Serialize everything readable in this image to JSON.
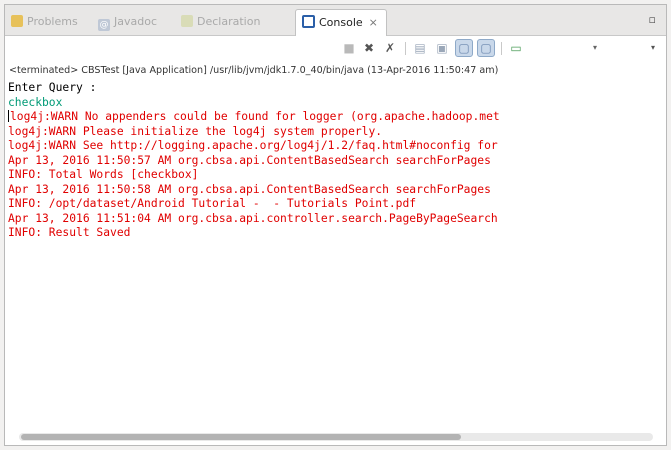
{
  "tabs": [
    {
      "label": "Problems",
      "icon": "problems-icon"
    },
    {
      "label": "Javadoc",
      "icon": "javadoc-icon"
    },
    {
      "label": "Declaration",
      "icon": "declaration-icon"
    },
    {
      "label": "Console",
      "icon": "console-icon",
      "close": "⨯"
    }
  ],
  "window": {
    "maximize_glyph": "▫"
  },
  "toolbar": {
    "buttons": [
      "terminate-icon",
      "remove-launch-icon",
      "remove-all-launches-icon",
      "clear-console-icon",
      "scroll-lock-icon",
      "show-stdout-icon",
      "show-stderr-icon",
      "pin-console-icon",
      "display-console-icon",
      "view-menu-icon"
    ]
  },
  "status_line": "<terminated> CBSTest [Java Application] /usr/lib/jvm/jdk1.7.0_40/bin/java (13-Apr-2016 11:50:47 am)",
  "console": {
    "lines": [
      {
        "text": "Enter Query :",
        "type": "out"
      },
      {
        "text": "checkbox",
        "type": "inp"
      },
      {
        "text": "log4j:WARN No appenders could be found for logger (org.apache.hadoop.met",
        "type": "err"
      },
      {
        "text": "log4j:WARN Please initialize the log4j system properly.",
        "type": "err"
      },
      {
        "text": "log4j:WARN See http://logging.apache.org/log4j/1.2/faq.html#noconfig for",
        "type": "err"
      },
      {
        "text": "Apr 13, 2016 11:50:57 AM org.cbsa.api.ContentBasedSearch searchForPages",
        "type": "err"
      },
      {
        "text": "INFO: Total Words [checkbox]",
        "type": "err"
      },
      {
        "text": "Apr 13, 2016 11:50:58 AM org.cbsa.api.ContentBasedSearch searchForPages",
        "type": "err"
      },
      {
        "text": "INFO: /opt/dataset/Android Tutorial -  - Tutorials Point.pdf",
        "type": "err"
      },
      {
        "text": "Apr 13, 2016 11:51:04 AM org.cbsa.api.controller.search.PageByPageSearch",
        "type": "err"
      },
      {
        "text": "INFO: Result Saved",
        "type": "err"
      }
    ]
  },
  "colors": {
    "stdout": "#000000",
    "stdin": "#009a76",
    "stderr": "#e00000"
  }
}
